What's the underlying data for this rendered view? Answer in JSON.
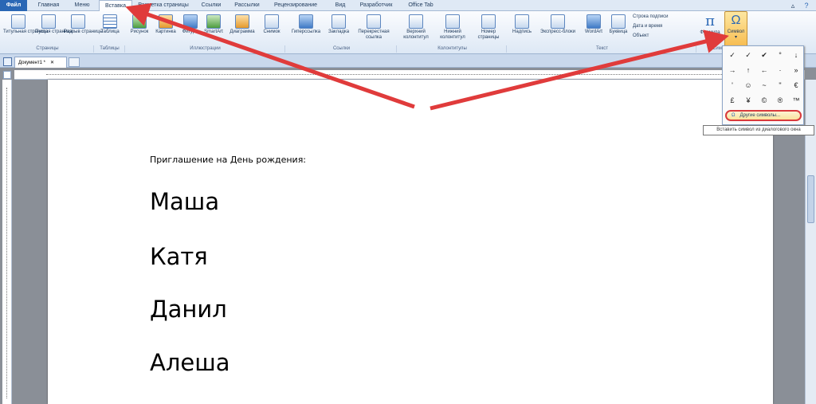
{
  "menubar": {
    "tabs": [
      "Файл",
      "Главная",
      "Меню",
      "Вставка",
      "Разметка страницы",
      "Ссылки",
      "Рассылки",
      "Рецензирование",
      "Вид",
      "Разработчик",
      "Office Tab"
    ]
  },
  "ribbon": {
    "pages": {
      "items": [
        "Титульная страница",
        "Пустая страница",
        "Разрыв страницы"
      ],
      "group": "Страницы"
    },
    "tables": {
      "items": [
        "Таблица"
      ],
      "group": "Таблицы"
    },
    "illustrations": {
      "items": [
        "Рисунок",
        "Картинка",
        "Фигуры",
        "SmartArt",
        "Диаграмма",
        "Снимок"
      ],
      "group": "Иллюстрации"
    },
    "links": {
      "items": [
        "Гиперссылка",
        "Закладка",
        "Перекрестная ссылка"
      ],
      "group": "Ссылки"
    },
    "headers": {
      "items": [
        "Верхний колонтитул",
        "Нижний колонтитул",
        "Номер страницы"
      ],
      "group": "Колонтитулы"
    },
    "text": {
      "items": [
        "Надпись",
        "Экспресс-блоки",
        "WordArt",
        "Буквица"
      ],
      "small": [
        "Строка подписи",
        "Дата и время",
        "Объект"
      ],
      "group": "Текст"
    },
    "symbols": {
      "items": [
        "Формула",
        "Символ"
      ],
      "group": "Символы"
    }
  },
  "document_tab": {
    "title": "Документ1 *"
  },
  "symbol_menu": {
    "symbols": [
      "✓",
      "✓",
      "✔",
      "°",
      "↓",
      "→",
      "↑",
      "←",
      "·",
      "»",
      "'",
      "☺",
      "~",
      "\"",
      "€",
      "£",
      "¥",
      "©",
      "®",
      "™"
    ],
    "more_label": "Другие символы...",
    "tooltip": "Вставить символ из диалогового окна"
  },
  "document": {
    "heading": "Приглашение  на День рождения:",
    "names": [
      "Маша",
      "Катя",
      "Данил",
      "Алеша"
    ]
  },
  "colors": {
    "annotation_arrow": "#e03b3b",
    "file_tab": "#2a67b5",
    "highlight": "#f7b847"
  }
}
